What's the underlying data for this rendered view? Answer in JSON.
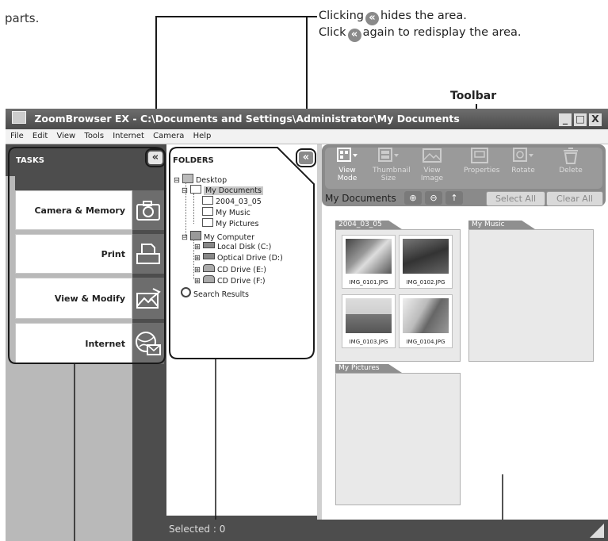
{
  "intro_text": "parts.",
  "callout_top": {
    "line1_before": "Clicking",
    "line1_after": "hides the area.",
    "line2_before": "Click",
    "line2_after": "again to redisplay the area.",
    "chevron_glyph": "«"
  },
  "callout_toolbar": "Toolbar",
  "window": {
    "title": "ZoomBrowser EX  -  C:\\Documents and Settings\\Administrator\\My Documents",
    "controls": [
      "_",
      "□",
      "X"
    ]
  },
  "menu": [
    "File",
    "Edit",
    "View",
    "Tools",
    "Internet",
    "Camera",
    "Help"
  ],
  "tasks": {
    "header": "TASKS",
    "items": [
      {
        "label": "Camera & Memory Card",
        "icon": "camera-icon"
      },
      {
        "label": "Print",
        "icon": "printer-icon"
      },
      {
        "label": "View & Modify",
        "icon": "view-modify-icon"
      },
      {
        "label": "Internet",
        "icon": "globe-mail-icon"
      }
    ]
  },
  "folders": {
    "header": "FOLDERS",
    "tree": [
      {
        "label": "Desktop",
        "level": 0,
        "icon": "desktop-icon",
        "expander": "⊟"
      },
      {
        "label": "My Documents",
        "level": 1,
        "icon": "open-folder-icon",
        "expander": "⊟",
        "selected": true
      },
      {
        "label": "2004_03_05",
        "level": 2,
        "icon": "folder-icon"
      },
      {
        "label": "My Music",
        "level": 2,
        "icon": "folder-icon"
      },
      {
        "label": "My Pictures",
        "level": 2,
        "icon": "folder-icon"
      },
      {
        "label": "My Computer",
        "level": 1,
        "icon": "computer-icon",
        "expander": "⊟"
      },
      {
        "label": "Local Disk (C:)",
        "level": 2,
        "icon": "drive-icon",
        "expander": "⊞"
      },
      {
        "label": "Optical Drive (D:)",
        "level": 2,
        "icon": "drive-icon",
        "expander": "⊞"
      },
      {
        "label": "CD Drive (E:)",
        "level": 2,
        "icon": "cd-icon",
        "expander": "⊞"
      },
      {
        "label": "CD Drive (F:)",
        "level": 2,
        "icon": "cd-icon",
        "expander": "⊞"
      },
      {
        "label": "Search Results",
        "level": 0,
        "icon": "search-icon"
      }
    ]
  },
  "toolbar": {
    "buttons": [
      {
        "label": "View Mode",
        "icon": "view-mode-icon",
        "active": true
      },
      {
        "label": "Thumbnail Size",
        "icon": "thumbnail-size-icon",
        "active": false
      },
      {
        "label": "View Image",
        "icon": "view-image-icon",
        "active": false
      },
      {
        "label": "Properties",
        "icon": "properties-icon",
        "active": false
      },
      {
        "label": "Rotate",
        "icon": "rotate-icon",
        "active": false
      },
      {
        "label": "Delete",
        "icon": "delete-icon",
        "active": false
      }
    ],
    "location": "My Documents",
    "select_all": "Select All",
    "clear_all": "Clear All"
  },
  "browser": {
    "groups": [
      {
        "name": "2004_03_05",
        "images": [
          "IMG_0101.JPG",
          "IMG_0102.JPG",
          "IMG_0103.JPG",
          "IMG_0104.JPG"
        ]
      },
      {
        "name": "My Music",
        "images": []
      },
      {
        "name": "My Pictures",
        "images": []
      }
    ]
  },
  "status": {
    "text": "Selected : 0"
  },
  "colors": {
    "dark_gray": "#4d4d4d",
    "panel_gray": "#b9b9b9",
    "toolbar_gray": "#8a8a8a",
    "white": "#ffffff"
  }
}
